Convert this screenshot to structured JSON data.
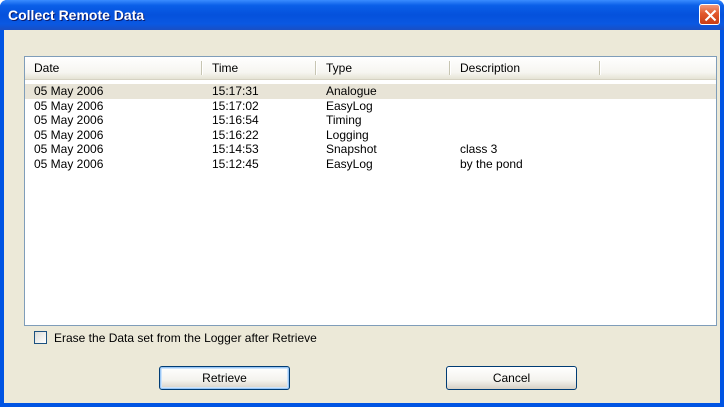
{
  "window": {
    "title": "Collect Remote Data"
  },
  "list": {
    "columns": [
      "Date",
      "Time",
      "Type",
      "Description"
    ],
    "rows": [
      {
        "date": "05 May 2006",
        "time": "15:17:31",
        "type": "Analogue",
        "description": "",
        "selected": true
      },
      {
        "date": "05 May 2006",
        "time": "15:17:02",
        "type": "EasyLog",
        "description": ""
      },
      {
        "date": "05 May 2006",
        "time": "15:16:54",
        "type": "Timing",
        "description": ""
      },
      {
        "date": "05 May 2006",
        "time": "15:16:22",
        "type": "Logging",
        "description": ""
      },
      {
        "date": "05 May 2006",
        "time": "15:14:53",
        "type": "Snapshot",
        "description": "class 3"
      },
      {
        "date": "05 May 2006",
        "time": "15:12:45",
        "type": "EasyLog",
        "description": "by the pond"
      }
    ]
  },
  "options": {
    "erase_label": "Erase the Data set from the Logger after Retrieve",
    "erase_checked": false
  },
  "buttons": {
    "retrieve": "Retrieve",
    "cancel": "Cancel"
  },
  "colors": {
    "titlebar": "#0551dc",
    "dialog_bg": "#ece9d8",
    "selected_row": "#e8e4d7"
  },
  "icons": {
    "close": "close-icon"
  }
}
